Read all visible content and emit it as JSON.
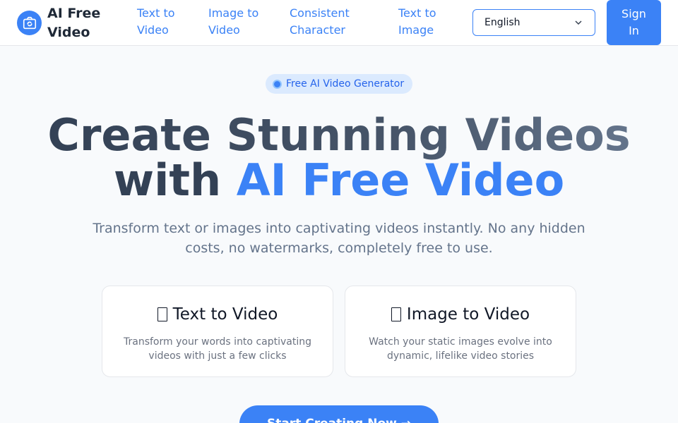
{
  "header": {
    "brand": "AI Free Video",
    "nav": [
      {
        "label": "Text to Video"
      },
      {
        "label": "Image to Video"
      },
      {
        "label": "Consistent Character"
      },
      {
        "label": "Text to Image"
      }
    ],
    "language": "English",
    "signin_label": "Sign In"
  },
  "hero": {
    "badge": "Free AI Video Generator",
    "title_line1": "Create Stunning Videos",
    "title_with": "with ",
    "title_accent": "AI Free Video",
    "subtitle": "Transform text or images into captivating videos instantly. No any hidden costs, no watermarks, completely free to use."
  },
  "cards": [
    {
      "title": "Text to Video",
      "icon": "file-icon",
      "desc": "Transform your words into captivating videos with just a few clicks"
    },
    {
      "title": "Image to Video",
      "icon": "file-icon",
      "desc": "Watch your static images evolve into dynamic, lifelike video stories"
    }
  ],
  "cta": {
    "label": "Start Creating Now →"
  },
  "colors": {
    "accent": "#3b82f6",
    "text": "#334155",
    "muted": "#64748b"
  }
}
